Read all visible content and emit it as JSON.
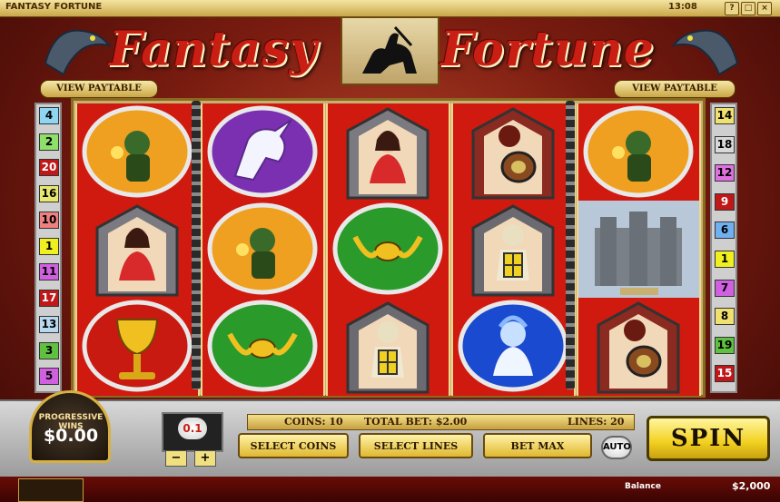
{
  "window": {
    "title": "FANTASY FORTUNE",
    "clock": "13:08",
    "buttons": [
      "?",
      "□",
      "×"
    ]
  },
  "logo": {
    "word1": "Fantasy",
    "word2": "Fortune"
  },
  "paytable": {
    "left_label": "VIEW PAYTABLE",
    "right_label": "VIEW PAYTABLE"
  },
  "left_lines": [
    {
      "num": "4",
      "color": "#8fd6f2"
    },
    {
      "num": "2",
      "color": "#8ee06a"
    },
    {
      "num": "20",
      "color": "#c01818"
    },
    {
      "num": "16",
      "color": "#e8e870"
    },
    {
      "num": "10",
      "color": "#f08080"
    },
    {
      "num": "1",
      "color": "#f0f020"
    },
    {
      "num": "11",
      "color": "#d060e0"
    },
    {
      "num": "17",
      "color": "#c01818"
    },
    {
      "num": "13",
      "color": "#b8d8f0"
    },
    {
      "num": "3",
      "color": "#60c040"
    },
    {
      "num": "5",
      "color": "#d060e0"
    }
  ],
  "right_lines": [
    {
      "num": "14",
      "color": "#f0e070"
    },
    {
      "num": "18",
      "color": "#d8d8d8"
    },
    {
      "num": "12",
      "color": "#e070e0"
    },
    {
      "num": "9",
      "color": "#c01818"
    },
    {
      "num": "6",
      "color": "#70b0f0"
    },
    {
      "num": "1",
      "color": "#f0f020"
    },
    {
      "num": "7",
      "color": "#d060e0"
    },
    {
      "num": "8",
      "color": "#f0e070"
    },
    {
      "num": "19",
      "color": "#60c040"
    },
    {
      "num": "15",
      "color": "#c01818"
    }
  ],
  "reels": [
    [
      "goblin",
      "lady",
      "chalice"
    ],
    [
      "unicorn",
      "goblin",
      "amulet"
    ],
    [
      "lady",
      "amulet",
      "knight"
    ],
    [
      "warrior",
      "knight",
      "ice-queen"
    ],
    [
      "goblin",
      "castle",
      "warrior"
    ]
  ],
  "symbol_colors": {
    "goblin": "#f0a020",
    "unicorn": "#7a30b0",
    "amulet": "#2a9a2a",
    "lady": "#7a7a80",
    "knight": "#6a6a70",
    "warrior": "#8a2a20",
    "chalice": "#c81a10",
    "ice-queen": "#1a4ad0",
    "castle": "#9aa0a8"
  },
  "progressive": {
    "label": "PROGRESSIVE WINS",
    "amount": "$0.00"
  },
  "coin": {
    "value": "0.1",
    "minus": "−",
    "plus": "+"
  },
  "info": {
    "coins": "COINS: 10",
    "total_bet": "TOTAL BET: $2.00",
    "lines": "LINES: 20"
  },
  "controls": {
    "select_coins": "SELECT COINS",
    "select_lines": "SELECT LINES",
    "bet_max": "BET MAX",
    "auto": "AUTO",
    "spin": "SPIN"
  },
  "balance": {
    "label": "Balance",
    "value": "$2,000"
  },
  "colors": {
    "reel_red": "#d01a10",
    "gold": "#e0b830",
    "logo_red": "#c81e14"
  }
}
